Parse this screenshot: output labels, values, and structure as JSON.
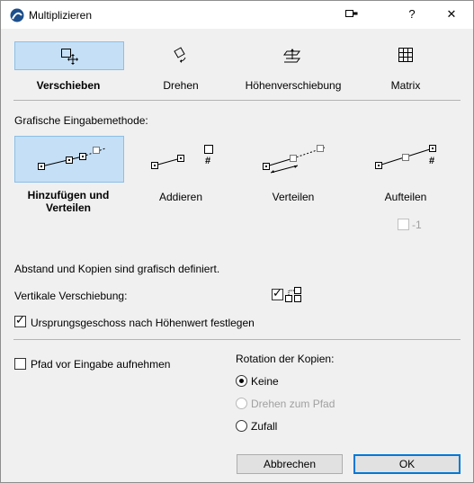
{
  "window": {
    "title": "Multiplizieren",
    "help_symbol": "?",
    "close_symbol": "✕"
  },
  "tabs": [
    {
      "label": "Verschieben",
      "icon": "move-icon"
    },
    {
      "label": "Drehen",
      "icon": "rotate-icon"
    },
    {
      "label": "Höhenverschiebung",
      "icon": "elevate-icon"
    },
    {
      "label": "Matrix",
      "icon": "matrix-icon"
    }
  ],
  "input_method": {
    "heading": "Grafische Eingabemethode:",
    "options": [
      {
        "label_line1": "Hinzufügen und",
        "label_line2": "Verteilen"
      },
      {
        "label_line1": "Addieren",
        "label_line2": ""
      },
      {
        "label_line1": "Verteilen",
        "label_line2": ""
      },
      {
        "label_line1": "Aufteilen",
        "label_line2": ""
      }
    ],
    "hash_symbol": "#",
    "minus_one": "-1"
  },
  "info_text": "Abstand und Kopien sind grafisch definiert.",
  "vertical_shift_label": "Vertikale Verschiebung:",
  "origin_floor_label": "Ursprungsgeschoss nach Höhenwert festlegen",
  "record_path_label": "Pfad vor Eingabe aufnehmen",
  "rotation": {
    "heading": "Rotation der Kopien:",
    "options": [
      "Keine",
      "Drehen zum Pfad",
      "Zufall"
    ]
  },
  "buttons": {
    "cancel": "Abbrechen",
    "ok": "OK"
  }
}
